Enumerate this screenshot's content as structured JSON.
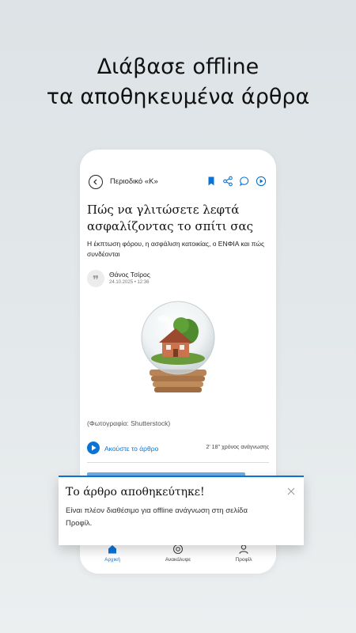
{
  "promo": {
    "line1": "Διάβασε offline",
    "line2": "τα αποθηκευμένα άρθρα"
  },
  "topbar": {
    "title": "Περιοδικό «Κ»",
    "icons": [
      "back-icon",
      "bookmark-icon",
      "share-icon",
      "comment-icon",
      "play-icon"
    ]
  },
  "article": {
    "title": "Πώς να γλιτώσετε λεφτά ασφαλίζοντας το σπίτι σας",
    "subtitle": "Η έκπτωση φόρου, η ασφάλιση κατοικίας, ο ΕΝΦΙΑ και πώς συνδέονται",
    "author": "Θάνος Τσίρος",
    "date": "24.10.2025 • 12:36",
    "caption": "(Φωτογραφία: Shutterstock)",
    "listen_label": "Ακούστε το άρθρο",
    "read_time": "2' 18'' χρόνος ανάγνωσης"
  },
  "toast": {
    "title": "Το άρθρο αποθηκεύτηκε!",
    "body": "Είναι πλέον διαθέσιμο για offline ανάγνωση στη σελίδα Προφίλ."
  },
  "nav": {
    "items": [
      {
        "label": "Αρχική",
        "active": true
      },
      {
        "label": "Ανακάλυψε",
        "active": false
      },
      {
        "label": "Προφίλ",
        "active": false
      }
    ]
  },
  "colors": {
    "accent": "#0a74d6",
    "background": "#e2e7ea"
  }
}
